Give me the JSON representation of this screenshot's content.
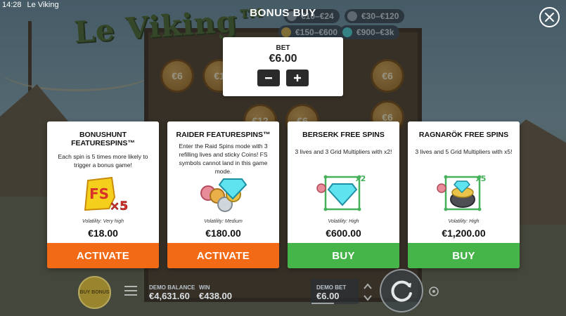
{
  "status_bar": {
    "time": "14:28",
    "app_name": "Le Viking"
  },
  "background": {
    "logo": "Le Viking™",
    "coin_values": [
      "€6",
      "€1",
      "€6",
      "€6",
      "€12",
      "€6"
    ],
    "prizes": [
      "€10–€24",
      "€30–€120",
      "€150–€600",
      "€900–€3k"
    ]
  },
  "header": {
    "title": "BONUS BUY"
  },
  "bet": {
    "label": "BET",
    "value": "€6.00",
    "decrease_icon": "minus-icon",
    "increase_icon": "plus-icon"
  },
  "cards": [
    {
      "title": "BONUSHUNT FEATURESPINS™",
      "description": "Each spin is 5 times more likely to trigger a bonus game!",
      "volatility": "Volatility: Very high",
      "price": "€18.00",
      "action": "ACTIVATE",
      "action_color": "#f26a15",
      "art": "fs-x5-symbol"
    },
    {
      "title": "RAIDER FEATURESPINS™",
      "description": "Enter the Raid Spins mode with 3 refilling lives and sticky Coins! FS symbols cannot land in this game mode.",
      "volatility": "Volatility: Medium",
      "price": "€180.00",
      "action": "ACTIVATE",
      "action_color": "#f26a15",
      "art": "coins-and-gem"
    },
    {
      "title": "BERSERK FREE SPINS",
      "description": "3 lives and 3 Grid Multipliers with x2!",
      "volatility": "Volatility: High",
      "price": "€600.00",
      "action": "BUY",
      "action_color": "#45b449",
      "art": "gem-x2-grid",
      "multiplier": "x2"
    },
    {
      "title": "RAGNARÖK FREE SPINS",
      "description": "3 lives and 5 Grid Multipliers with x5!",
      "volatility": "Volatility: High",
      "price": "€1,200.00",
      "action": "BUY",
      "action_color": "#45b449",
      "art": "pot-x5-grid",
      "multiplier": "x5"
    }
  ],
  "bottom_bar": {
    "buy_bonus": "BUY BONUS",
    "demo_balance_label": "DEMO BALANCE",
    "demo_balance": "€4,631.60",
    "win_label": "WIN",
    "win": "€438.00",
    "demo_bet_label": "DEMO BET",
    "demo_bet": "€6.00"
  },
  "colors": {
    "activate": "#f26a15",
    "buy": "#45b449",
    "panel": "#ffffff"
  }
}
